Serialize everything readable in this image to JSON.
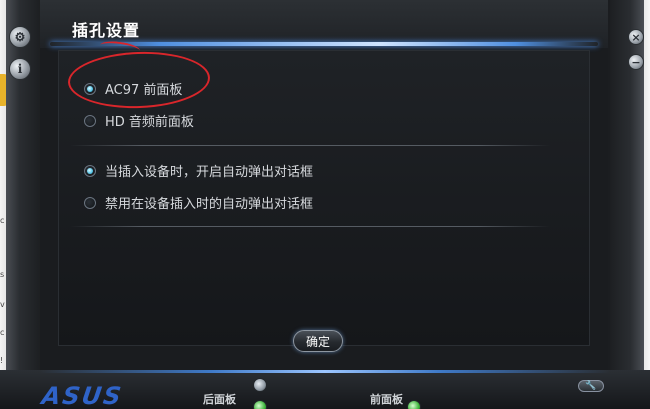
{
  "dialog": {
    "title": "插孔设置"
  },
  "connector_options": [
    {
      "label": "AC97 前面板",
      "checked": true
    },
    {
      "label": "HD 音频前面板",
      "checked": false
    }
  ],
  "popup_options": [
    {
      "label": "当插入设备时，开启自动弹出对话框",
      "checked": true
    },
    {
      "label": "禁用在设备插入时的自动弹出对话框",
      "checked": false
    }
  ],
  "buttons": {
    "ok_label": "确定"
  },
  "bottom": {
    "logo": "ASUS",
    "rear_panel_label": "后面板",
    "front_panel_label": "前面板"
  },
  "frame_icons": {
    "left_top": "gear-icon",
    "left_bottom": "info-icon",
    "right_top": "close-icon",
    "right_bottom": "minimize-icon"
  },
  "side_marks": [
    "c",
    "s",
    "v",
    "c",
    "!"
  ],
  "colors": {
    "accent_blue": "#4f8fe0",
    "annotation_red": "#d9262b",
    "radio_checked": "#56c6e8",
    "jack_green": "#3db33a"
  }
}
